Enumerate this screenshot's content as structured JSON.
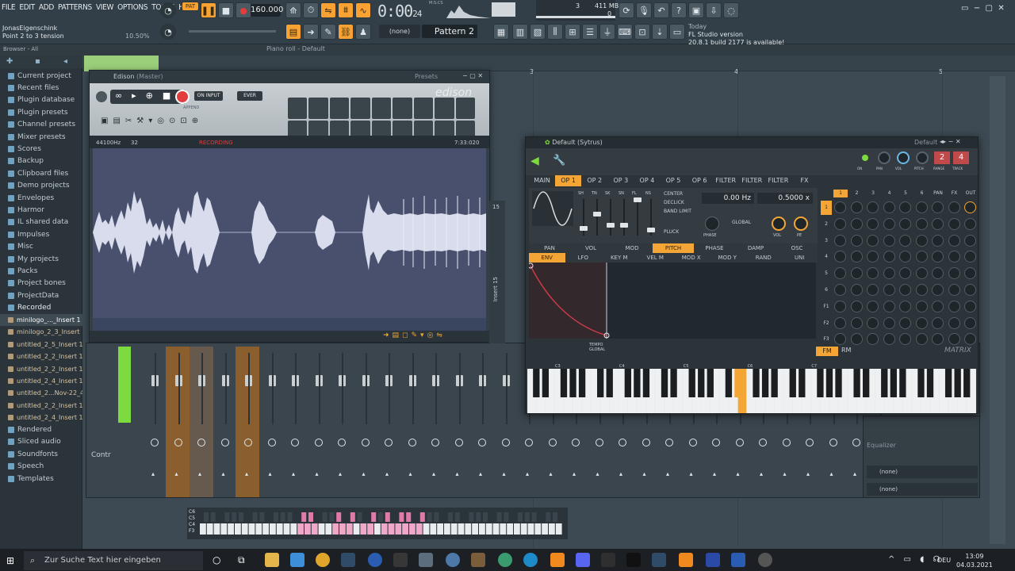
{
  "menu": [
    "FILE",
    "EDIT",
    "ADD",
    "PATTERNS",
    "VIEW",
    "OPTIONS",
    "TOOLS",
    "HELP"
  ],
  "toolbar": {
    "pat_label": "PAT",
    "tempo": "160.000",
    "time_main": "0:00",
    "time_sub": "24",
    "time_unit_label": "M:S:CS",
    "cpu_value": "3",
    "memory": "411 MB",
    "memory_sub": "0",
    "pattern": "Pattern 2",
    "none_label": "(none)"
  },
  "hint": {
    "line1": "JonasEigenschink",
    "line2": "Point 2 to 3 tension",
    "percent": "10.50%"
  },
  "news": {
    "today": "Today",
    "title": "FL Studio version",
    "body": "20.8.1 build 2177 is available!"
  },
  "browser": {
    "header": "Browser - All",
    "items": [
      {
        "label": "Current project",
        "sub": false
      },
      {
        "label": "Recent files",
        "sub": false
      },
      {
        "label": "Plugin database",
        "sub": false
      },
      {
        "label": "Plugin presets",
        "sub": false
      },
      {
        "label": "Channel presets",
        "sub": false
      },
      {
        "label": "Mixer presets",
        "sub": false
      },
      {
        "label": "Scores",
        "sub": false
      },
      {
        "label": "Backup",
        "sub": false
      },
      {
        "label": "Clipboard files",
        "sub": false
      },
      {
        "label": "Demo projects",
        "sub": false
      },
      {
        "label": "Envelopes",
        "sub": false
      },
      {
        "label": "Harmor",
        "sub": false
      },
      {
        "label": "IL shared data",
        "sub": false
      },
      {
        "label": "Impulses",
        "sub": false
      },
      {
        "label": "Misc",
        "sub": false
      },
      {
        "label": "My projects",
        "sub": false
      },
      {
        "label": "Packs",
        "sub": false
      },
      {
        "label": "Project bones",
        "sub": false
      },
      {
        "label": "ProjectData",
        "sub": false
      },
      {
        "label": "Recorded",
        "sub": false,
        "bold": true
      },
      {
        "label": "minilogo_..._Insert 1",
        "sub": true,
        "hl": true
      },
      {
        "label": "minilogo_2_3_Insert 1",
        "sub": true
      },
      {
        "label": "untitled_2_5_Insert 1",
        "sub": true
      },
      {
        "label": "untitled_2_2_Insert 1",
        "sub": true
      },
      {
        "label": "untitled_2_2_Insert 1",
        "sub": true
      },
      {
        "label": "untitled_2_4_Insert 1",
        "sub": true
      },
      {
        "label": "untitled_2...Nov-22_4",
        "sub": true
      },
      {
        "label": "untitled_2_2_Insert 1",
        "sub": true
      },
      {
        "label": "untitled_2_4_Insert 1",
        "sub": true
      },
      {
        "label": "Rendered",
        "sub": false
      },
      {
        "label": "Sliced audio",
        "sub": false
      },
      {
        "label": "Soundfonts",
        "sub": false
      },
      {
        "label": "Speech",
        "sub": false
      },
      {
        "label": "Templates",
        "sub": false
      }
    ]
  },
  "pianoroll": {
    "title": "Piano roll - Default",
    "ruler": [
      "3",
      "4",
      "5"
    ]
  },
  "edison": {
    "title": "Edison",
    "title_sub": "(Master)",
    "presets": "Presets",
    "on_input": "ON INPUT",
    "ever": "EVER",
    "append": "APPEND",
    "sample_rate": "44100Hz",
    "bits": "32",
    "recording": "RECORDING",
    "duration": "7:33:020",
    "logo": "edison"
  },
  "sytrus": {
    "title": "Default (Sytrus)",
    "preset": "Default",
    "knobs": [
      "ON",
      "PAN",
      "VOL",
      "PITCH",
      "RANGE",
      "TRACK"
    ],
    "range_val": "2",
    "track_val": "4",
    "tabs": [
      "MAIN",
      "OP 1",
      "OP 2",
      "OP 3",
      "OP 4",
      "OP 5",
      "OP 6",
      "FILTER 1",
      "FILTER 2",
      "FILTER 3",
      "FX"
    ],
    "active_tab": "OP 1",
    "sliders": [
      "SH",
      "TN",
      "SK",
      "SN",
      "FL",
      "NS"
    ],
    "options": [
      "CENTER",
      "DECLICK",
      "BAND LIMIT",
      "PLUCK"
    ],
    "hz": "0.00 Hz",
    "ratio": "0.5000 x",
    "global": "GLOBAL",
    "phase": "PHASE",
    "vol": "VOL",
    "pe": "PE",
    "tabs2": [
      "PAN",
      "VOL",
      "MOD",
      "PITCH",
      "PHASE",
      "DAMP",
      "OSC"
    ],
    "active_tab2": "PITCH",
    "tabs3": [
      "ENV",
      "LFO",
      "KEY M",
      "VEL M",
      "MOD X",
      "MOD Y",
      "RAND",
      "UNI"
    ],
    "active_tab3": "ENV",
    "tempo_label": "TEMPO",
    "global_label": "GLOBAL",
    "fm": "FM",
    "rm": "RM",
    "matrix": "MATRIX",
    "matrix_cols": [
      "1",
      "2",
      "3",
      "4",
      "5",
      "6",
      "PAN",
      "FX",
      "OUT"
    ],
    "matrix_rows": [
      "1",
      "2",
      "3",
      "4",
      "5",
      "6",
      "F1",
      "F2",
      "F3"
    ],
    "octaves": [
      "C3",
      "C4",
      "C5",
      "C6",
      "C7"
    ]
  },
  "mixer": {
    "label": "Contr",
    "insert_label": "Insert 15",
    "insert_num": "15"
  },
  "eq": {
    "title": "Equalizer",
    "slot1": "(none)",
    "slot2": "(none)"
  },
  "stepseq": {
    "notes": [
      "C6",
      "C5",
      "C4",
      "F3"
    ]
  },
  "taskbar": {
    "search": "Zur Suche Text hier eingeben",
    "lang": "DEU",
    "time": "13:09",
    "date": "04.03.2021"
  },
  "colors": {
    "accent": "#f7a233",
    "panel": "#333f48",
    "wave_bg": "#48506e",
    "wave": "#d9dcec",
    "red": "#e23c3c"
  }
}
